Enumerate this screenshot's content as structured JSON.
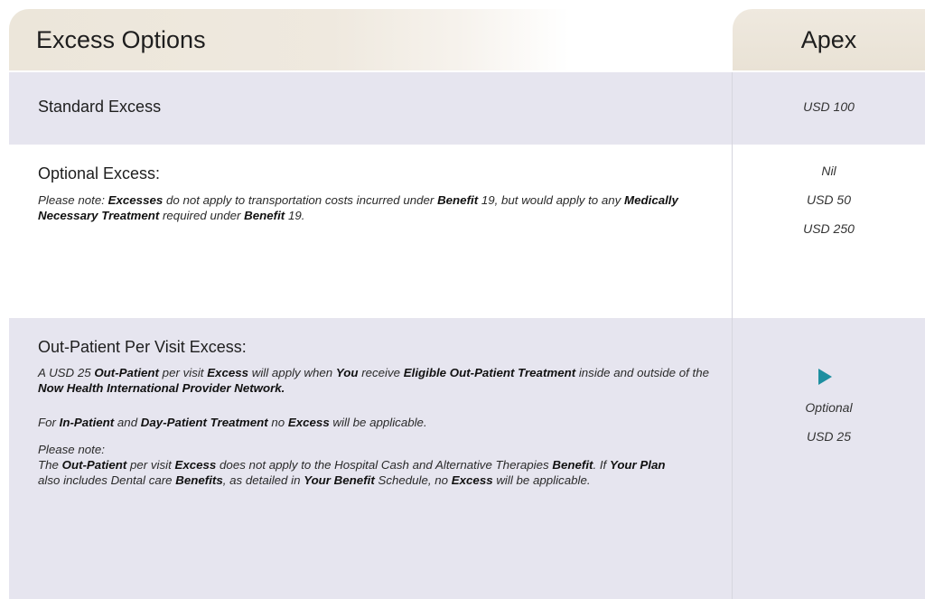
{
  "header": {
    "left_title": "Excess Options",
    "plan_name": "Apex"
  },
  "standard_excess": {
    "label": "Standard Excess",
    "value": "USD 100"
  },
  "optional_excess": {
    "label": "Optional Excess:",
    "note_prefix": "Please note: ",
    "note_t1": "Excesses",
    "note_t2": " do not apply to transportation costs incurred under ",
    "note_t3": "Benefit",
    "note_t4": " 19, but would apply to any ",
    "note_t5": "Medically Necessary Treatment",
    "note_t6": " required under ",
    "note_t7": "Benefit",
    "note_t8": " 19.",
    "values": [
      "Nil",
      "USD 50",
      "USD 250"
    ]
  },
  "outpatient_excess": {
    "label": "Out-Patient Per Visit Excess:",
    "p1_t1": "A USD 25 ",
    "p1_t2": "Out-Patient",
    "p1_t3": " per visit ",
    "p1_t4": "Excess",
    "p1_t5": " will apply when ",
    "p1_t6": "You",
    "p1_t7": " receive ",
    "p1_t8": "Eligible Out-Patient Treatment",
    "p1_t9": " inside and outside of the ",
    "p1_t10": "Now Health International Provider Network.",
    "p2_t1": "For ",
    "p2_t2": "In-Patient",
    "p2_t3": " and ",
    "p2_t4": "Day-Patient Treatment",
    "p2_t5": " no ",
    "p2_t6": "Excess",
    "p2_t7": " will be applicable.",
    "p3_t1": "Please note:",
    "p3_t2": "The ",
    "p3_t3": "Out-Patient",
    "p3_t4": " per visit ",
    "p3_t5": "Excess",
    "p3_t6": " does not apply to the Hospital Cash and Alternative Therapies ",
    "p3_t7": "Benefit",
    "p3_t8": ". If ",
    "p3_t9": "Your Plan",
    "p3_t10": " also includes Dental care ",
    "p3_t11": "Benefits",
    "p3_t12": ", as detailed in ",
    "p3_t13": "Your Benefit",
    "p3_t14": " Schedule, no ",
    "p3_t15": "Excess",
    "p3_t16": " will be applicable.",
    "option_label": "Optional",
    "option_value": "USD 25",
    "arrow_icon": "play-arrow-icon",
    "arrow_color": "#1e8fa0"
  },
  "colors": {
    "row_shade": "#e6e5ef",
    "header_tan": "#ece6da"
  }
}
